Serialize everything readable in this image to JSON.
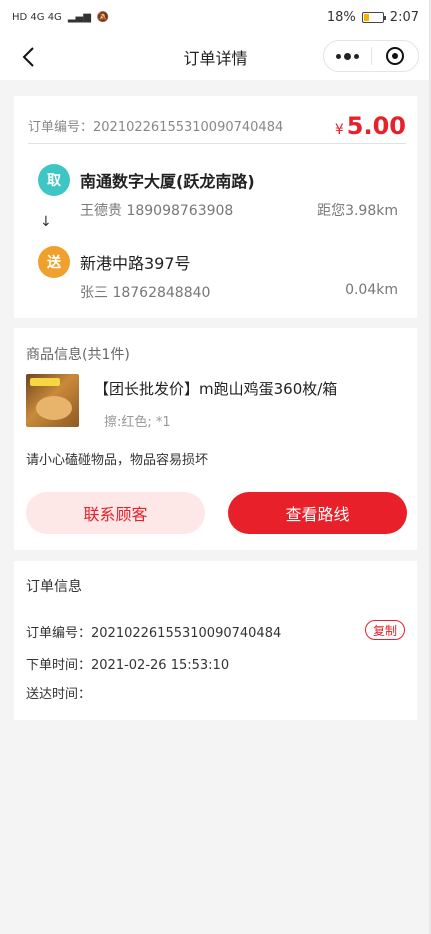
{
  "status_bar": {
    "left": "HD 4G 4G",
    "battery": "18%",
    "time": "2:07"
  },
  "nav": {
    "title": "订单详情"
  },
  "order": {
    "order_no_label": "订单编号：",
    "order_no": "20210226155310090740484",
    "currency": "¥",
    "amount": "5.00"
  },
  "pickup": {
    "badge": "取",
    "address": "南通数字大厦(跃龙南路)",
    "contact": "王德贵 189098763908",
    "distance": "距您3.98km"
  },
  "dropoff": {
    "badge": "送",
    "address": "新港中路397号",
    "contact": "张三 18762848840",
    "distance": "0.04km"
  },
  "goods": {
    "title": "商品信息(共1件)",
    "name": "【团长批发价】m跑山鸡蛋360枚/箱",
    "spec": "擦:红色; *1",
    "remark": "请小心磕碰物品，物品容易损坏"
  },
  "actions": {
    "contact_label": "联系顾客",
    "route_label": "查看路线"
  },
  "order_info": {
    "title": "订单信息",
    "order_no_label": "订单编号：",
    "order_no": "20210226155310090740484",
    "copy_label": "复制",
    "order_time_label": "下单时间：",
    "order_time": "2021-02-26 15:53:10",
    "delivered_label": "送达时间：",
    "delivered_time": ""
  },
  "colors": {
    "accent": "#e8202a",
    "pickup_badge": "#3ec6c5",
    "dropoff_badge": "#f0a02c"
  }
}
